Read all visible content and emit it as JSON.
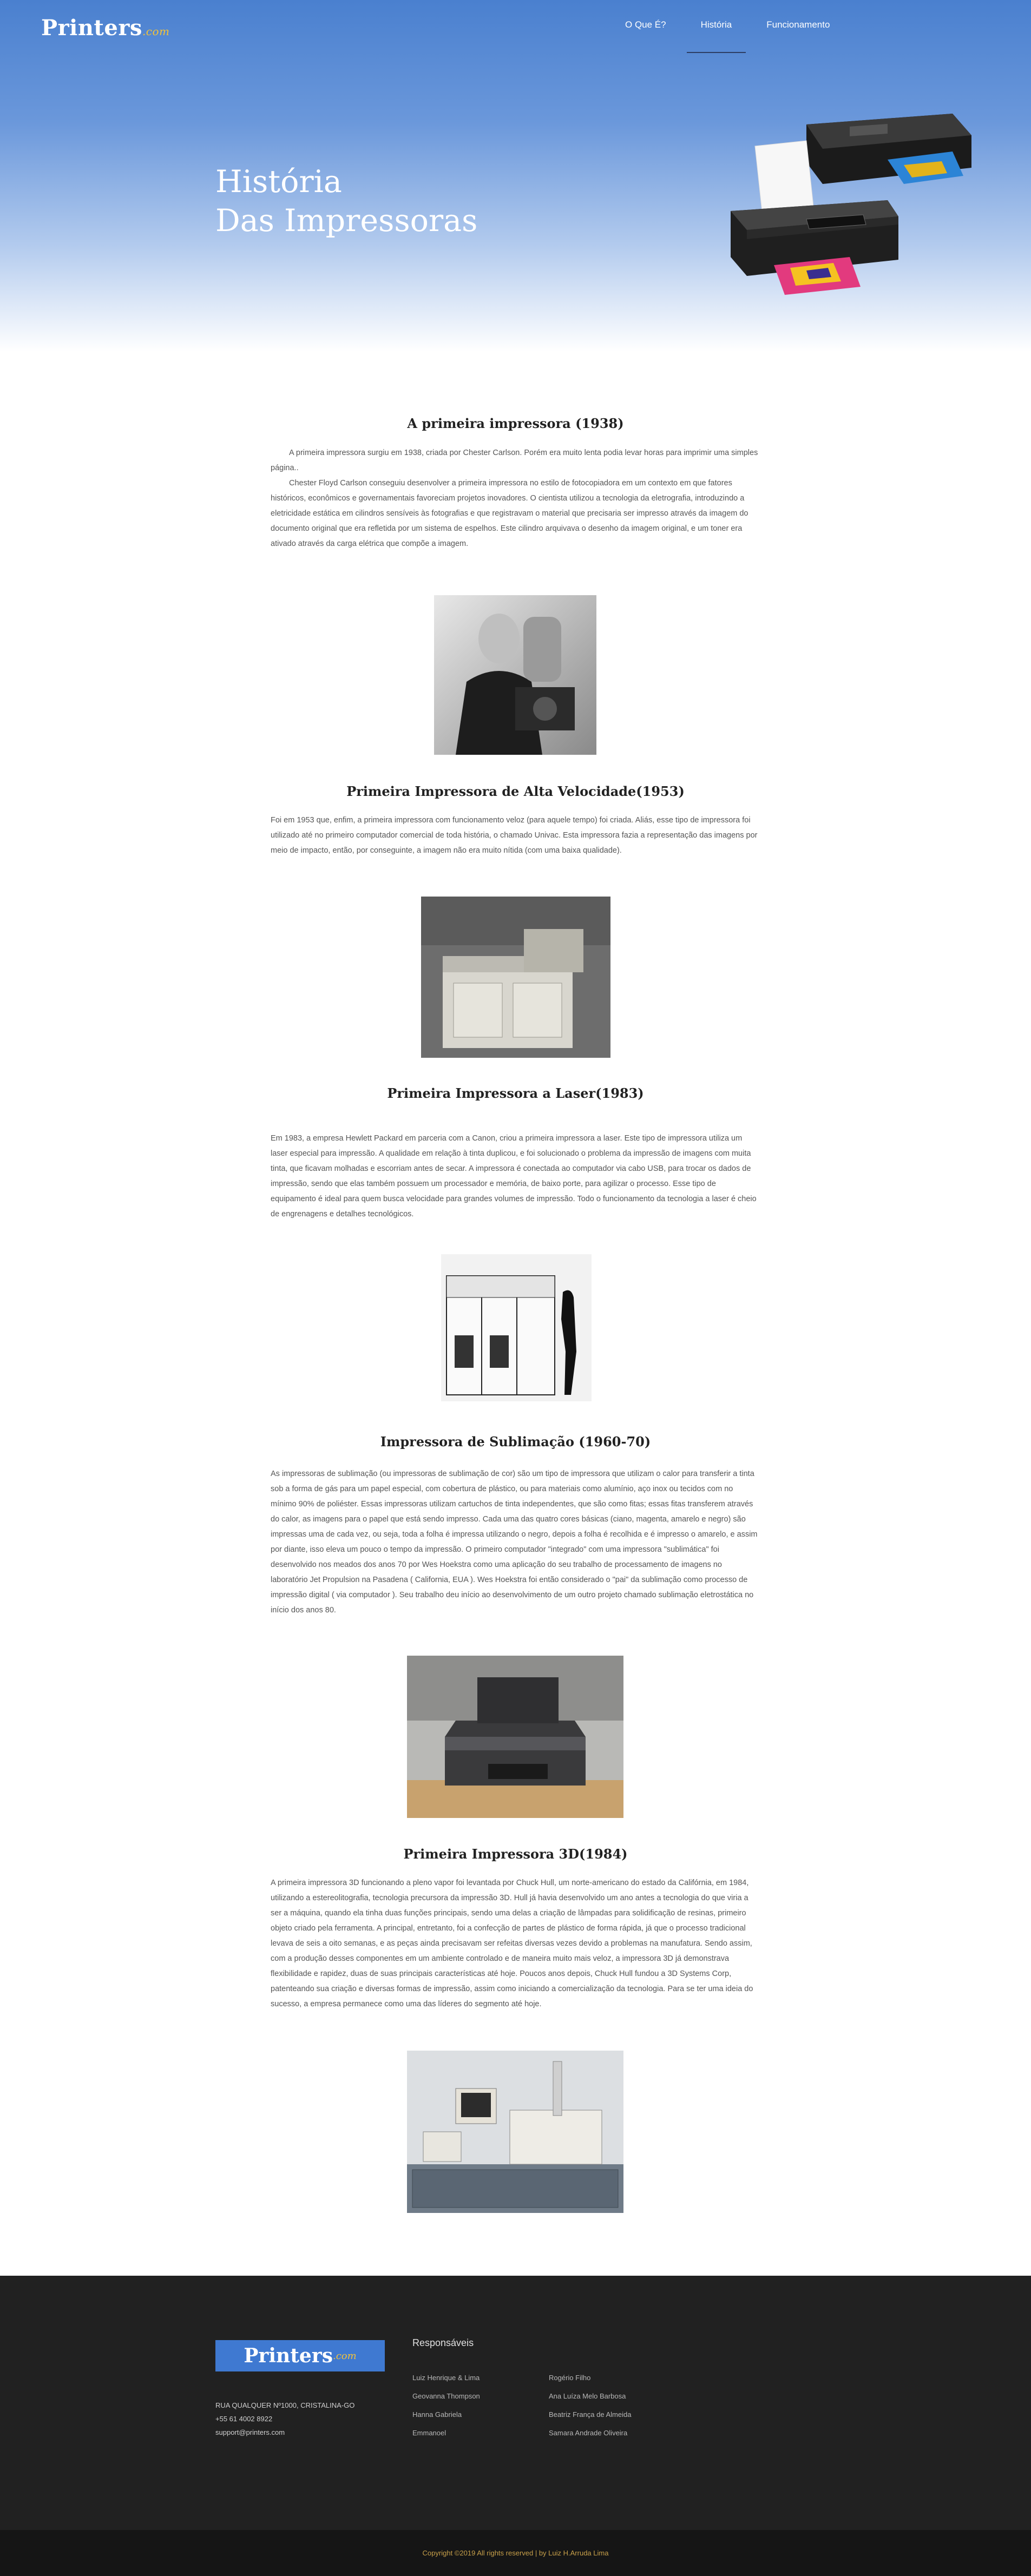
{
  "header": {
    "logo_main": "Printers",
    "logo_domain": ".com",
    "nav": [
      {
        "label": "O Que É?",
        "active": false
      },
      {
        "label": "História",
        "active": true
      },
      {
        "label": "Funcionamento",
        "active": false
      }
    ]
  },
  "hero": {
    "title_line1": "História",
    "title_line2": "Das Impressoras"
  },
  "sections": [
    {
      "title": "A primeira impressora (1938)",
      "paragraphs": [
        "A primeira impressora surgiu em 1938, criada por Chester Carlson. Porém era muito lenta podia levar horas para imprimir uma simples página..",
        "Chester Floyd Carlson conseguiu desenvolver a primeira impressora no estilo de fotocopiadora em um contexto em que fatores históricos, econômicos e governamentais favoreciam projetos inovadores. O cientista utilizou a tecnologia da eletrografia, introduzindo a eletricidade estática em cilindros sensíveis às fotografias e que registravam o material que precisaria ser impresso através da imagem do documento original que era refletida por um sistema de espelhos. Este cilindro arquivava o desenho da imagem original, e um toner era ativado através da carga elétrica que compõe a imagem."
      ]
    },
    {
      "title": "Primeira Impressora de Alta Velocidade(1953)",
      "paragraphs": [
        "Foi em 1953 que, enfim, a primeira impressora com funcionamento veloz (para aquele tempo) foi criada. Aliás, esse tipo de impressora foi utilizado até no primeiro computador comercial de toda história, o chamado Univac. Esta impressora fazia a representação das imagens por meio de impacto, então, por conseguinte, a imagem não era muito nítida (com uma baixa qualidade)."
      ]
    },
    {
      "title": "Primeira Impressora a Laser(1983)",
      "paragraphs": [
        "Em 1983, a empresa Hewlett Packard em parceria com a Canon, criou a primeira impressora a laser. Este tipo de impressora utiliza um laser especial para impressão. A qualidade em relação à tinta duplicou, e foi solucionado o problema da impressão de imagens com muita tinta, que ficavam molhadas e escorriam antes de secar. A impressora é conectada ao computador via cabo USB, para trocar os dados de impressão, sendo que elas também possuem um processador e memória, de baixo porte, para agilizar o processo. Esse tipo de equipamento é ideal para quem busca velocidade para grandes volumes de impressão. Todo o funcionamento da tecnologia a laser é cheio de engrenagens e detalhes tecnológicos."
      ]
    },
    {
      "title": "Impressora de Sublimação (1960-70)",
      "paragraphs": [
        "As impressoras de sublimação (ou impressoras de sublimação de cor) são um tipo de impressora que utilizam o calor para transferir a tinta sob a forma de gás para um papel especial, com cobertura de plástico, ou para materiais como alumínio, aço inox ou tecidos com no mínimo 90% de poliéster. Essas impressoras utilizam cartuchos de tinta independentes, que são como fitas; essas fitas transferem através do calor, as imagens para o papel que está sendo impresso. Cada uma das quatro cores básicas (ciano, magenta, amarelo e negro) são impressas uma de cada vez, ou seja, toda a folha é impressa utilizando o negro, depois a folha é recolhida e é impresso o amarelo, e assim por diante, isso eleva um pouco o tempo da impressão. O primeiro computador \"integrado\" com uma impressora \"sublimática\" foi desenvolvido nos meados dos anos 70 por Wes Hoekstra como uma aplicação do seu trabalho de processamento de imagens no laboratório Jet Propulsion na Pasadena ( California, EUA ). Wes Hoekstra foi então considerado o \"pai\" da sublimação como processo de impressão digital ( via computador ). Seu trabalho deu início ao desenvolvimento de um outro projeto chamado sublimação eletrostática no início dos anos 80."
      ]
    },
    {
      "title": "Primeira Impressora 3D(1984)",
      "paragraphs": [
        "A primeira impressora 3D funcionando a pleno vapor foi levantada por Chuck Hull, um norte-americano do estado da Califórnia, em 1984, utilizando a estereolitografia, tecnologia precursora da impressão 3D. Hull já havia desenvolvido um ano antes a tecnologia do que viria a ser a máquina, quando ela tinha duas funções principais, sendo uma delas a criação de lâmpadas para solidificação de resinas, primeiro objeto criado pela ferramenta. A principal, entretanto, foi a confecção de partes de plástico de forma rápida, já que o processo tradicional levava de seis a oito semanas, e as peças ainda precisavam ser refeitas diversas vezes devido a problemas na manufatura. Sendo assim, com a produção desses componentes em um ambiente controlado e de maneira muito mais veloz, a impressora 3D já demonstrava flexibilidade e rapidez, duas de suas principais características até hoje. Poucos anos depois, Chuck Hull fundou a 3D Systems Corp, patenteando sua criação e diversas formas de impressão, assim como iniciando a comercialização da tecnologia. Para se ter uma ideia do sucesso, a empresa permanece como uma das líderes do segmento até hoje."
      ]
    }
  ],
  "footer": {
    "logo_main": "Printers",
    "logo_domain": ".com",
    "address": "RUA QUALQUER Nº1000, CRISTALINA-GO",
    "phone": "+55 61 4002 8922",
    "email": "support@printers.com",
    "responsaveis_heading": "Responsáveis",
    "names": [
      "Luiz Henrique & Lima",
      "Rogério Filho",
      "Geovanna Thompson",
      "Ana Luíza Melo Barbosa",
      "Hanna Gabriela",
      "Beatriz França de Almeida",
      "Emmanoel",
      "Samara Andrade Oliveira"
    ],
    "copyright": "Copyright ©2019 All rights reserved | by Luiz H.Arruda Lima"
  }
}
